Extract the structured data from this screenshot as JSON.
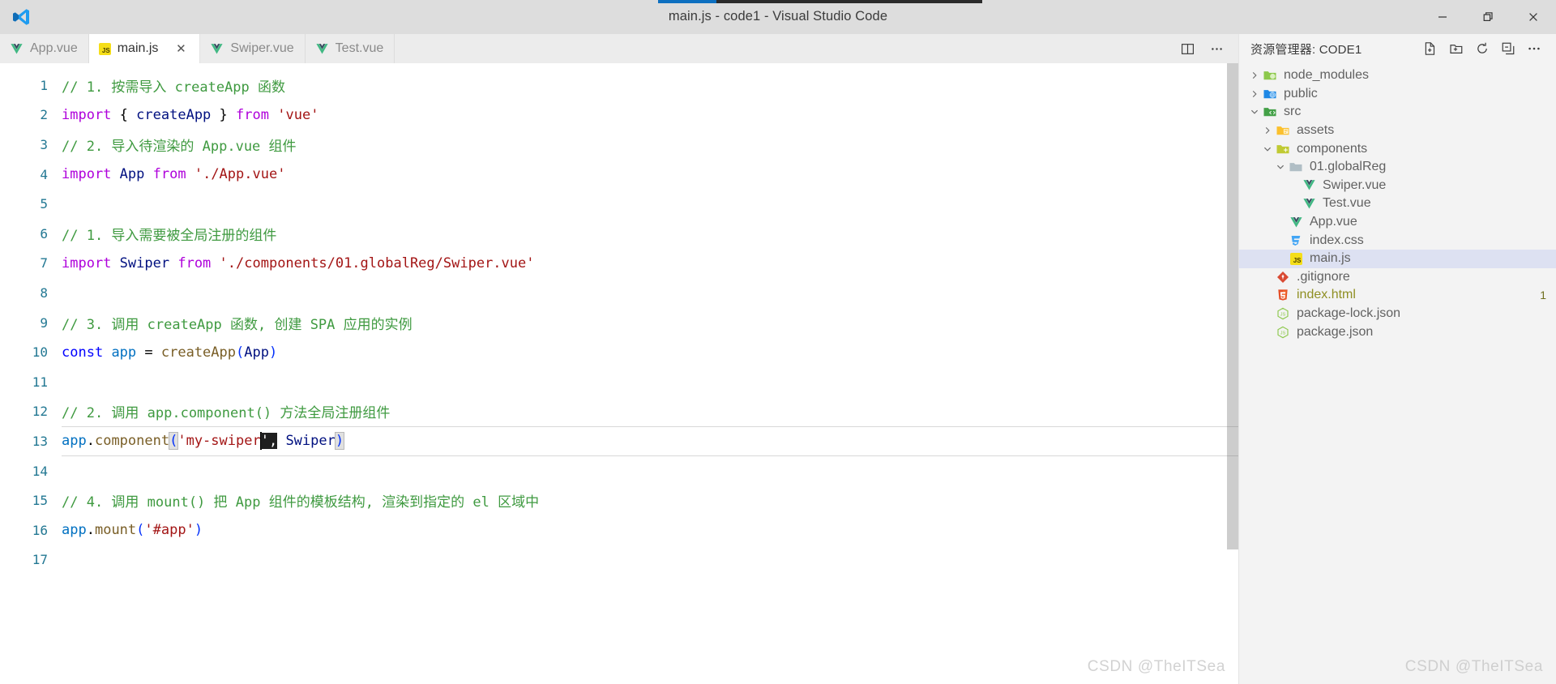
{
  "window": {
    "title": "main.js - code1 - Visual Studio Code",
    "logo_icon": "vscode-logo",
    "minimize_label": "Minimize",
    "maximize_label": "Restore",
    "close_label": "Close",
    "progress": {
      "value": 18,
      "track_color": "#2b2b2b",
      "fill_color": "#0e70c0"
    }
  },
  "tabs": [
    {
      "label": "App.vue",
      "icon": "vue-icon",
      "active": false,
      "closable": false
    },
    {
      "label": "main.js",
      "icon": "js-icon",
      "active": true,
      "closable": true,
      "close_glyph": "✕"
    },
    {
      "label": "Swiper.vue",
      "icon": "vue-icon",
      "active": false,
      "closable": false
    },
    {
      "label": "Test.vue",
      "icon": "vue-icon",
      "active": false,
      "closable": false
    }
  ],
  "editor_actions": [
    {
      "name": "split-editor-right",
      "icon": "split-editor-icon",
      "label": "Split Editor Right"
    },
    {
      "name": "more-actions",
      "icon": "ellipsis-icon",
      "label": "More Actions..."
    }
  ],
  "editor": {
    "language": "javascript",
    "current_line": 13,
    "watermark": "CSDN @TheITSea",
    "lines": [
      {
        "n": 1,
        "tokens": [
          {
            "t": "// 1. 按需导入 createApp 函数",
            "c": "t-comment"
          }
        ]
      },
      {
        "n": 2,
        "tokens": [
          {
            "t": "import",
            "c": "t-keyword"
          },
          {
            "t": " ",
            "c": "t-punct"
          },
          {
            "t": "{",
            "c": "t-punct"
          },
          {
            "t": " ",
            "c": "t-punct"
          },
          {
            "t": "createApp",
            "c": "t-var"
          },
          {
            "t": " ",
            "c": "t-punct"
          },
          {
            "t": "}",
            "c": "t-punct"
          },
          {
            "t": " ",
            "c": "t-punct"
          },
          {
            "t": "from",
            "c": "t-keyword"
          },
          {
            "t": " ",
            "c": "t-punct"
          },
          {
            "t": "'vue'",
            "c": "t-string"
          }
        ]
      },
      {
        "n": 3,
        "tokens": [
          {
            "t": "// 2. 导入待渲染的 App.vue 组件",
            "c": "t-comment"
          }
        ]
      },
      {
        "n": 4,
        "tokens": [
          {
            "t": "import",
            "c": "t-keyword"
          },
          {
            "t": " ",
            "c": "t-punct"
          },
          {
            "t": "App",
            "c": "t-var"
          },
          {
            "t": " ",
            "c": "t-punct"
          },
          {
            "t": "from",
            "c": "t-keyword"
          },
          {
            "t": " ",
            "c": "t-punct"
          },
          {
            "t": "'./App.vue'",
            "c": "t-string"
          }
        ]
      },
      {
        "n": 5,
        "tokens": []
      },
      {
        "n": 6,
        "tokens": [
          {
            "t": "// 1. 导入需要被全局注册的组件",
            "c": "t-comment"
          }
        ]
      },
      {
        "n": 7,
        "tokens": [
          {
            "t": "import",
            "c": "t-keyword"
          },
          {
            "t": " ",
            "c": "t-punct"
          },
          {
            "t": "Swiper",
            "c": "t-var"
          },
          {
            "t": " ",
            "c": "t-punct"
          },
          {
            "t": "from",
            "c": "t-keyword"
          },
          {
            "t": " ",
            "c": "t-punct"
          },
          {
            "t": "'./components/01.globalReg/Swiper.vue'",
            "c": "t-string"
          }
        ]
      },
      {
        "n": 8,
        "tokens": []
      },
      {
        "n": 9,
        "tokens": [
          {
            "t": "// 3. 调用 createApp 函数, 创建 SPA 应用的实例",
            "c": "t-comment"
          }
        ]
      },
      {
        "n": 10,
        "tokens": [
          {
            "t": "const",
            "c": "t-control"
          },
          {
            "t": " ",
            "c": "t-punct"
          },
          {
            "t": "app",
            "c": "t-local"
          },
          {
            "t": " = ",
            "c": "t-punct"
          },
          {
            "t": "createApp",
            "c": "t-func"
          },
          {
            "t": "(",
            "c": "t-paren1"
          },
          {
            "t": "App",
            "c": "t-var"
          },
          {
            "t": ")",
            "c": "t-paren1"
          }
        ]
      },
      {
        "n": 11,
        "tokens": []
      },
      {
        "n": 12,
        "tokens": [
          {
            "t": "// 2. 调用 app.component() 方法全局注册组件",
            "c": "t-comment"
          }
        ]
      },
      {
        "n": 13,
        "tokens": [
          {
            "t": "app",
            "c": "t-local"
          },
          {
            "t": ".",
            "c": "t-punct"
          },
          {
            "t": "component",
            "c": "t-func"
          },
          {
            "t": "(",
            "c": "t-paren1 bracket-hl"
          },
          {
            "t": "'my-swiper",
            "c": "t-string"
          },
          {
            "t": "caret",
            "c": "caret"
          },
          {
            "t": "',",
            "c": "sel-block"
          },
          {
            "t": " ",
            "c": "t-punct"
          },
          {
            "t": "Swiper",
            "c": "t-var"
          },
          {
            "t": ")",
            "c": "t-paren1 bracket-hl"
          }
        ]
      },
      {
        "n": 14,
        "tokens": []
      },
      {
        "n": 15,
        "tokens": [
          {
            "t": "// 4. 调用 mount() 把 App 组件的模板结构, 渲染到指定的 el 区域中",
            "c": "t-comment"
          }
        ]
      },
      {
        "n": 16,
        "tokens": [
          {
            "t": "app",
            "c": "t-local"
          },
          {
            "t": ".",
            "c": "t-punct"
          },
          {
            "t": "mount",
            "c": "t-func"
          },
          {
            "t": "(",
            "c": "t-paren1"
          },
          {
            "t": "'#app'",
            "c": "t-string"
          },
          {
            "t": ")",
            "c": "t-paren1"
          }
        ]
      },
      {
        "n": 17,
        "tokens": []
      }
    ]
  },
  "sidebar": {
    "title": "资源管理器: CODE1",
    "actions": [
      {
        "name": "new-file",
        "icon": "new-file-icon",
        "label": "新建文件"
      },
      {
        "name": "new-folder",
        "icon": "new-folder-icon",
        "label": "新建文件夹"
      },
      {
        "name": "refresh-explorer",
        "icon": "refresh-icon",
        "label": "在资源管理器中刷新"
      },
      {
        "name": "collapse-all",
        "icon": "collapse-icon",
        "label": "在资源管理器中折叠文件夹"
      },
      {
        "name": "views-and-more",
        "icon": "ellipsis-icon",
        "label": "视图和更多操作..."
      }
    ],
    "tree": [
      {
        "label": "node_modules",
        "type": "folder",
        "icon": "folder-node-icon",
        "depth": 0,
        "state": "collapsed",
        "selected": false
      },
      {
        "label": "public",
        "type": "folder",
        "icon": "folder-public-icon",
        "depth": 0,
        "state": "collapsed",
        "selected": false
      },
      {
        "label": "src",
        "type": "folder",
        "icon": "folder-src-icon",
        "depth": 0,
        "state": "expanded",
        "selected": false
      },
      {
        "label": "assets",
        "type": "folder",
        "icon": "folder-assets-icon",
        "depth": 1,
        "state": "collapsed",
        "selected": false
      },
      {
        "label": "components",
        "type": "folder",
        "icon": "folder-components-icon",
        "depth": 1,
        "state": "expanded",
        "selected": false
      },
      {
        "label": "01.globalReg",
        "type": "folder",
        "icon": "folder-icon",
        "depth": 2,
        "state": "expanded",
        "selected": false
      },
      {
        "label": "Swiper.vue",
        "type": "file",
        "icon": "vue-icon",
        "depth": 3,
        "state": "none",
        "selected": false
      },
      {
        "label": "Test.vue",
        "type": "file",
        "icon": "vue-icon",
        "depth": 3,
        "state": "none",
        "selected": false
      },
      {
        "label": "App.vue",
        "type": "file",
        "icon": "vue-icon",
        "depth": 2,
        "state": "none",
        "selected": false
      },
      {
        "label": "index.css",
        "type": "file",
        "icon": "css-icon",
        "depth": 2,
        "state": "none",
        "selected": false
      },
      {
        "label": "main.js",
        "type": "file",
        "icon": "js-icon",
        "depth": 2,
        "state": "none",
        "selected": true
      },
      {
        "label": ".gitignore",
        "type": "file",
        "icon": "git-icon",
        "depth": 1,
        "state": "none",
        "selected": false
      },
      {
        "label": "index.html",
        "type": "file",
        "icon": "html-icon",
        "depth": 1,
        "state": "none",
        "selected": false,
        "badge": "1",
        "git": "modified"
      },
      {
        "label": "package-lock.json",
        "type": "file",
        "icon": "node-json-icon",
        "depth": 1,
        "state": "none",
        "selected": false
      },
      {
        "label": "package.json",
        "type": "file",
        "icon": "node-json-icon",
        "depth": 1,
        "state": "none",
        "selected": false
      }
    ],
    "watermark": "CSDN @TheITSea"
  },
  "colors": {
    "titlebar_bg": "#dddddd",
    "tabbar_bg": "#ececec",
    "editor_bg": "#ffffff",
    "sidebar_bg": "#f3f3f3",
    "selection_bg": "#dde1f2",
    "accent": "#0e70c0",
    "line_number": "#237893"
  }
}
